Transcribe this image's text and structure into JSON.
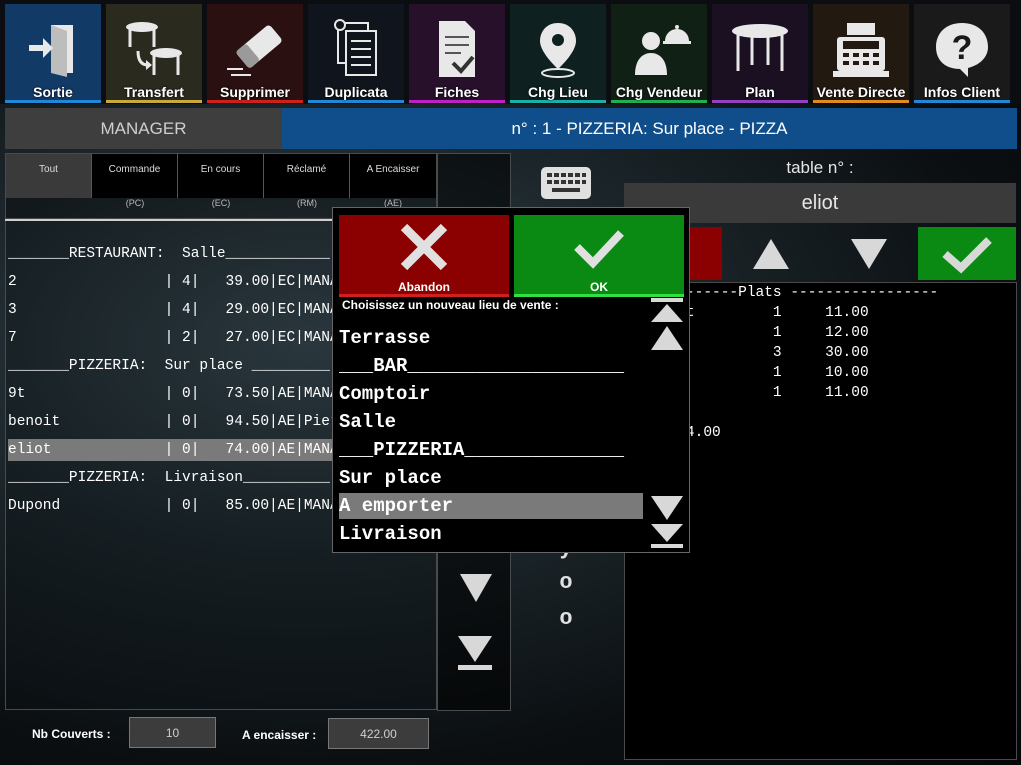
{
  "colors": {
    "accent_blue": "#1f88d8",
    "header_blue": "#0f4e8a",
    "abandon_red": "#8b0000",
    "ok_green": "#0a8a12",
    "selected_row": "#7a7a7a"
  },
  "toolbar": {
    "buttons": [
      {
        "label": "Sortie",
        "icon": "exit-door-icon",
        "bg": "#123a66",
        "underline": "#1f88d8"
      },
      {
        "label": "Transfert",
        "icon": "table-transfer-icon",
        "bg": "#2a2a1e",
        "underline": "#c9a93a"
      },
      {
        "label": "Supprimer",
        "icon": "eraser-icon",
        "bg": "#2a1010",
        "underline": "#d0201a"
      },
      {
        "label": "Duplicata",
        "icon": "document-copy-icon",
        "bg": "#10141c",
        "underline": "#1f88d8"
      },
      {
        "label": "Fiches",
        "icon": "checklist-icon",
        "bg": "#26102a",
        "underline": "#c020c8"
      },
      {
        "label": "Chg Lieu",
        "icon": "map-pin-icon",
        "bg": "#0e2020",
        "underline": "#18b0a8"
      },
      {
        "label": "Chg Vendeur",
        "icon": "waiter-icon",
        "bg": "#102014",
        "underline": "#20b050"
      },
      {
        "label": "Plan",
        "icon": "table-plan-icon",
        "bg": "#1a1022",
        "underline": "#9040c0"
      },
      {
        "label": "Vente Directe",
        "icon": "cash-register-icon",
        "bg": "#221a10",
        "underline": "#e08a20"
      },
      {
        "label": "Infos Client",
        "icon": "help-icon",
        "bg": "#1a1a1a",
        "underline": "#1f88d8"
      }
    ]
  },
  "header": {
    "user": "MANAGER",
    "title": "n° : 1 - PIZZERIA: Sur place  - PIZZA"
  },
  "tabs": [
    {
      "label": "Tout",
      "sub": ""
    },
    {
      "label": "Commande",
      "sub": "(PC)"
    },
    {
      "label": "En cours",
      "sub": "(EC)"
    },
    {
      "label": "Réclamé",
      "sub": "(RM)"
    },
    {
      "label": "A Encaisser",
      "sub": "(AE)"
    }
  ],
  "list_rows": [
    "_______RESTAURANT:  Salle____________",
    "2                 | 4|   39.00|EC|MANAGER",
    "3                 | 4|   29.00|EC|MANAGER",
    "7                 | 2|   27.00|EC|MANAGER",
    "_______PIZZERIA:  Sur place _________",
    "9t                | 0|   73.50|AE|MANAGER",
    "benoit            | 0|   94.50|AE|Pierre",
    "eliot             | 0|   74.00|AE|MANAGER",
    "_______PIZZERIA:  Livraison__________",
    "Dupond            | 0|   85.00|AE|MANAGER"
  ],
  "right_panel": {
    "table_label": "table  n° :",
    "table_name": "eliot",
    "order_lines": [
      "-------------Plats -----------------",
      "u moment         1     11.00",
      "ière             1     12.00",
      "                 3     30.00",
      " Miel            1     10.00",
      "e                1     11.00",
      "",
      "",
      "      74.00"
    ]
  },
  "side_chars": [
    "y",
    "o",
    "o"
  ],
  "footer": {
    "covers_label": "Nb Couverts :",
    "covers_value": "10",
    "to_collect_label": "A encaisser :",
    "to_collect_value": "422.00"
  },
  "dialog": {
    "abandon_label": "Abandon",
    "ok_label": "OK",
    "prompt": "Choisissez un nouveau lieu de vente :",
    "options": [
      "Terrasse",
      "___BAR___________________",
      "Comptoir",
      "Salle",
      "___PIZZERIA______________",
      "Sur place",
      "A emporter",
      "Livraison"
    ],
    "selected_option": "A emporter"
  }
}
